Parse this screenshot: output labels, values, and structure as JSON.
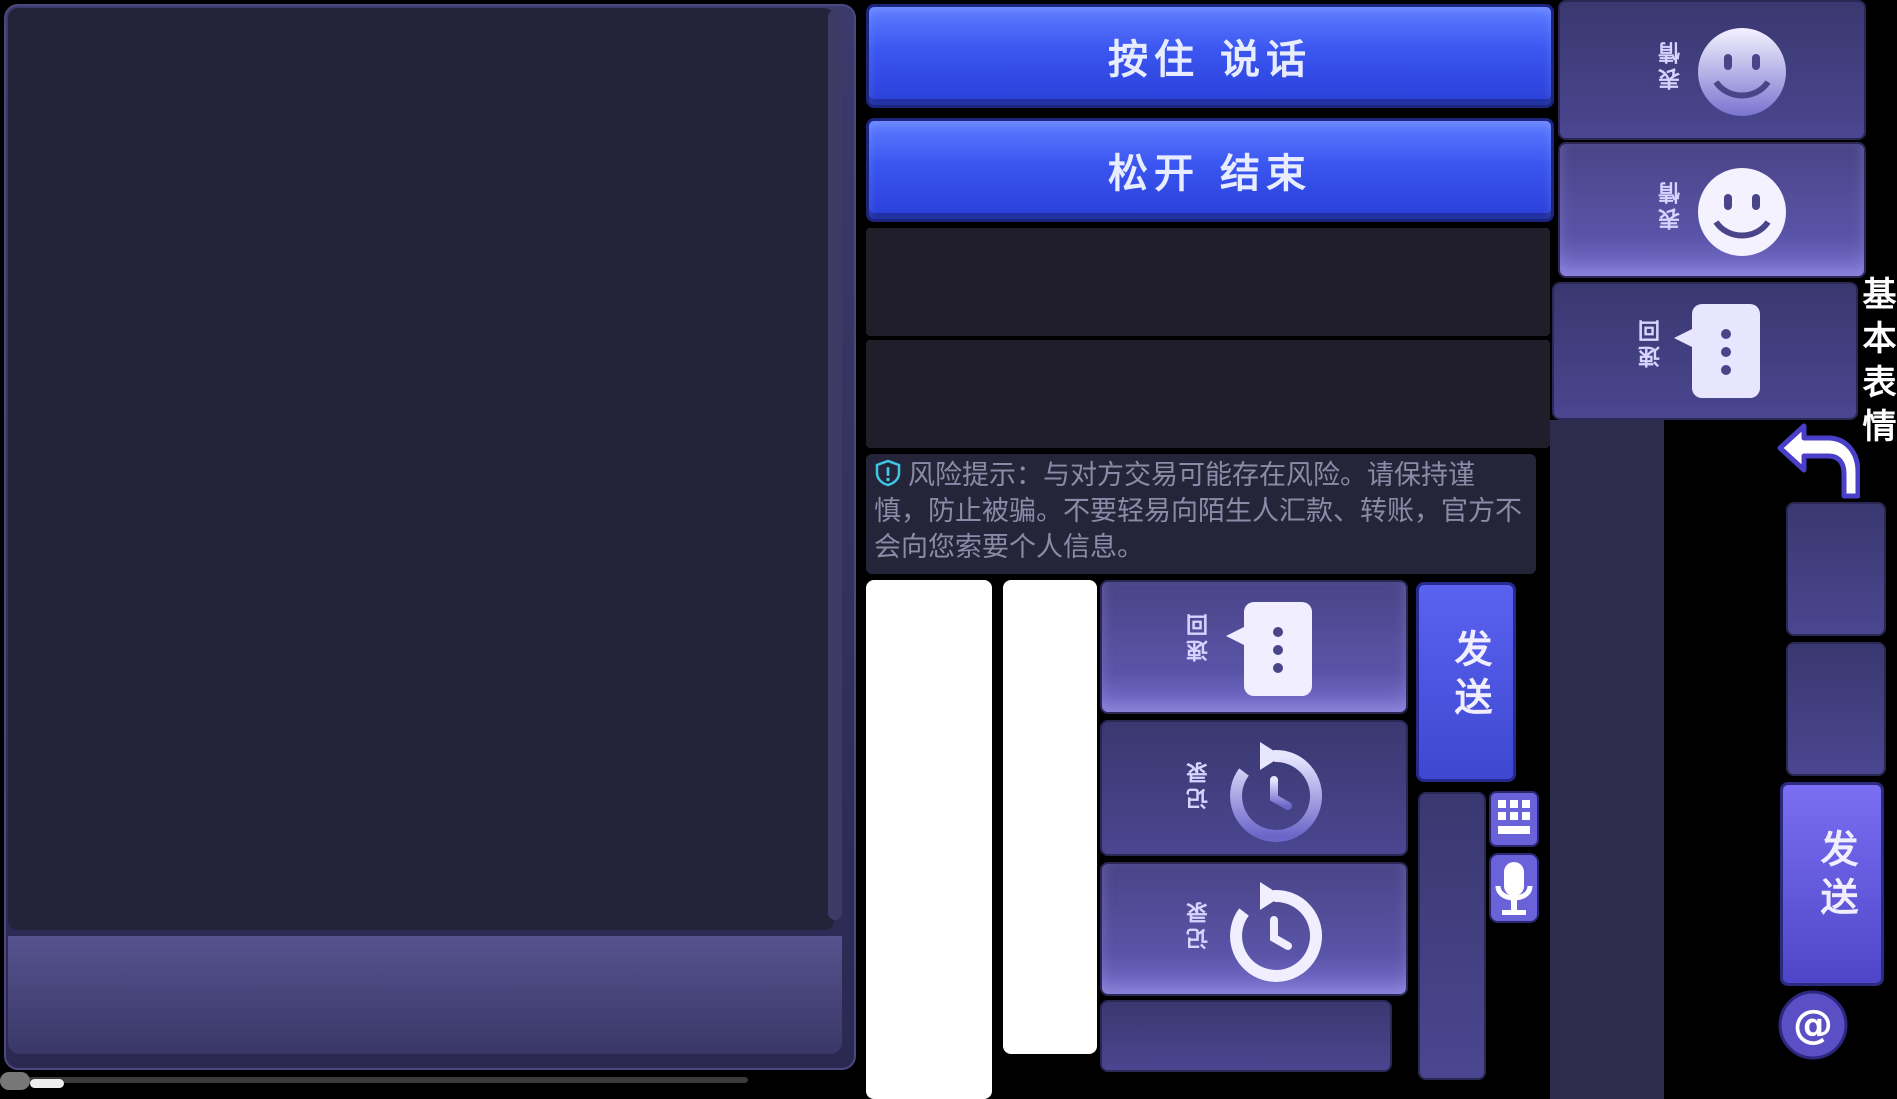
{
  "voice": {
    "hold_label": "按住  说话",
    "release_label": "松开  结束"
  },
  "risk_notice": {
    "text": "风险提示：与对方交易可能存在风险。请保持谨慎，防止被骗。不要轻易向陌生人汇款、转账，官方不会向您索要个人信息。"
  },
  "buttons": {
    "quick_reply": "速回",
    "history": "记录",
    "emoji": "表情",
    "send": "发送"
  },
  "side_text": {
    "basic_emoji": "基本表情"
  },
  "colors": {
    "accent_blue": "#3a55f0",
    "panel_purple": "#4a4488",
    "background": "#000000"
  },
  "icons": [
    "shield-alert-icon",
    "speech-bubble-icon",
    "history-clock-icon",
    "smiley-icon",
    "keyboard-icon",
    "microphone-icon",
    "back-arrow-icon",
    "at-sign-icon"
  ]
}
